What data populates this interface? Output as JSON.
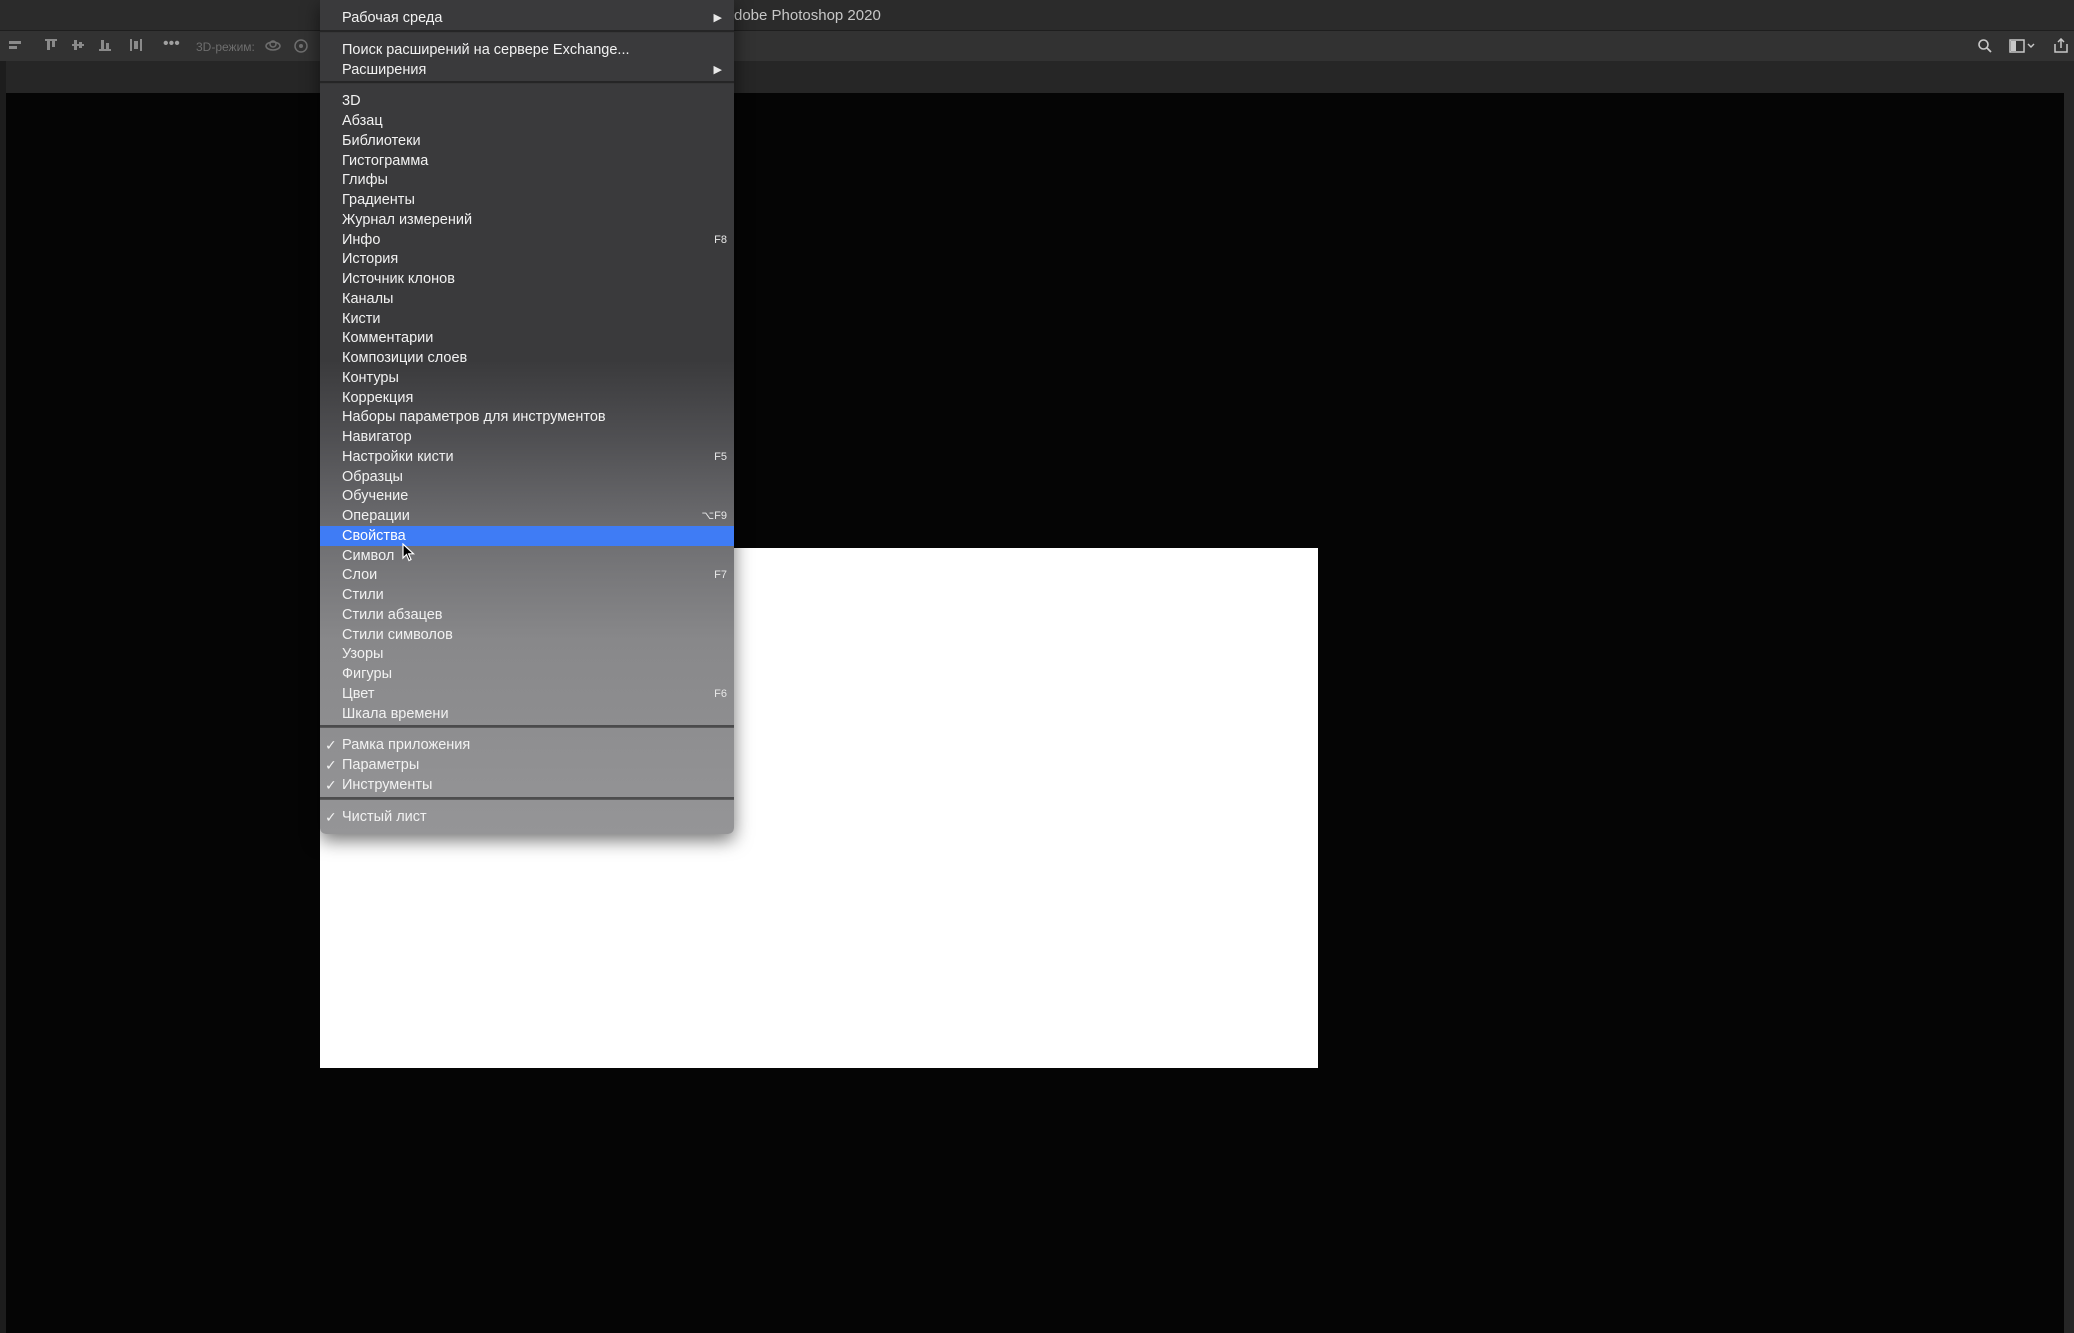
{
  "window": {
    "title": "dobe Photoshop 2020"
  },
  "optionsbar": {
    "mode_3d_label": "3D-режим:",
    "icons": [
      "align-left-icon",
      "align-top-icon",
      "align-vcenter-icon",
      "align-bottom-icon",
      "distribute-icon",
      "more-icon",
      "orbit-3d-icon",
      "roll-3d-icon",
      "search-icon",
      "workspace-icon",
      "share-icon"
    ]
  },
  "menu": {
    "highlight_color": "#3f7cf5",
    "items": [
      {
        "label": "Рабочая среда",
        "submenu": true
      },
      {
        "label": "Поиск расширений на сервере Exchange..."
      },
      {
        "label": "Расширения",
        "submenu": true
      },
      {
        "label": "3D"
      },
      {
        "label": "Абзац"
      },
      {
        "label": "Библиотеки"
      },
      {
        "label": "Гистограмма"
      },
      {
        "label": "Глифы"
      },
      {
        "label": "Градиенты"
      },
      {
        "label": "Журнал измерений"
      },
      {
        "label": "Инфо",
        "shortcut": "F8"
      },
      {
        "label": "История"
      },
      {
        "label": "Источник клонов"
      },
      {
        "label": "Каналы"
      },
      {
        "label": "Кисти"
      },
      {
        "label": "Комментарии"
      },
      {
        "label": "Композиции слоев"
      },
      {
        "label": "Контуры"
      },
      {
        "label": "Коррекция"
      },
      {
        "label": "Наборы параметров для инструментов"
      },
      {
        "label": "Навигатор"
      },
      {
        "label": "Настройки кисти",
        "shortcut": "F5"
      },
      {
        "label": "Образцы"
      },
      {
        "label": "Обучение"
      },
      {
        "label": "Операции",
        "shortcut": "⌥F9"
      },
      {
        "label": "Свойства",
        "highlighted": true
      },
      {
        "label": "Символ"
      },
      {
        "label": "Слои",
        "shortcut": "F7"
      },
      {
        "label": "Стили"
      },
      {
        "label": "Стили абзацев"
      },
      {
        "label": "Стили символов"
      },
      {
        "label": "Узоры"
      },
      {
        "label": "Фигуры"
      },
      {
        "label": "Цвет",
        "shortcut": "F6"
      },
      {
        "label": "Шкала времени"
      },
      {
        "label": "Рамка приложения",
        "checked": true
      },
      {
        "label": "Параметры",
        "checked": true
      },
      {
        "label": "Инструменты",
        "checked": true
      },
      {
        "label": "Чистый лист",
        "checked": true
      }
    ],
    "check_glyph": "✓",
    "arrow_glyph": "▶"
  }
}
